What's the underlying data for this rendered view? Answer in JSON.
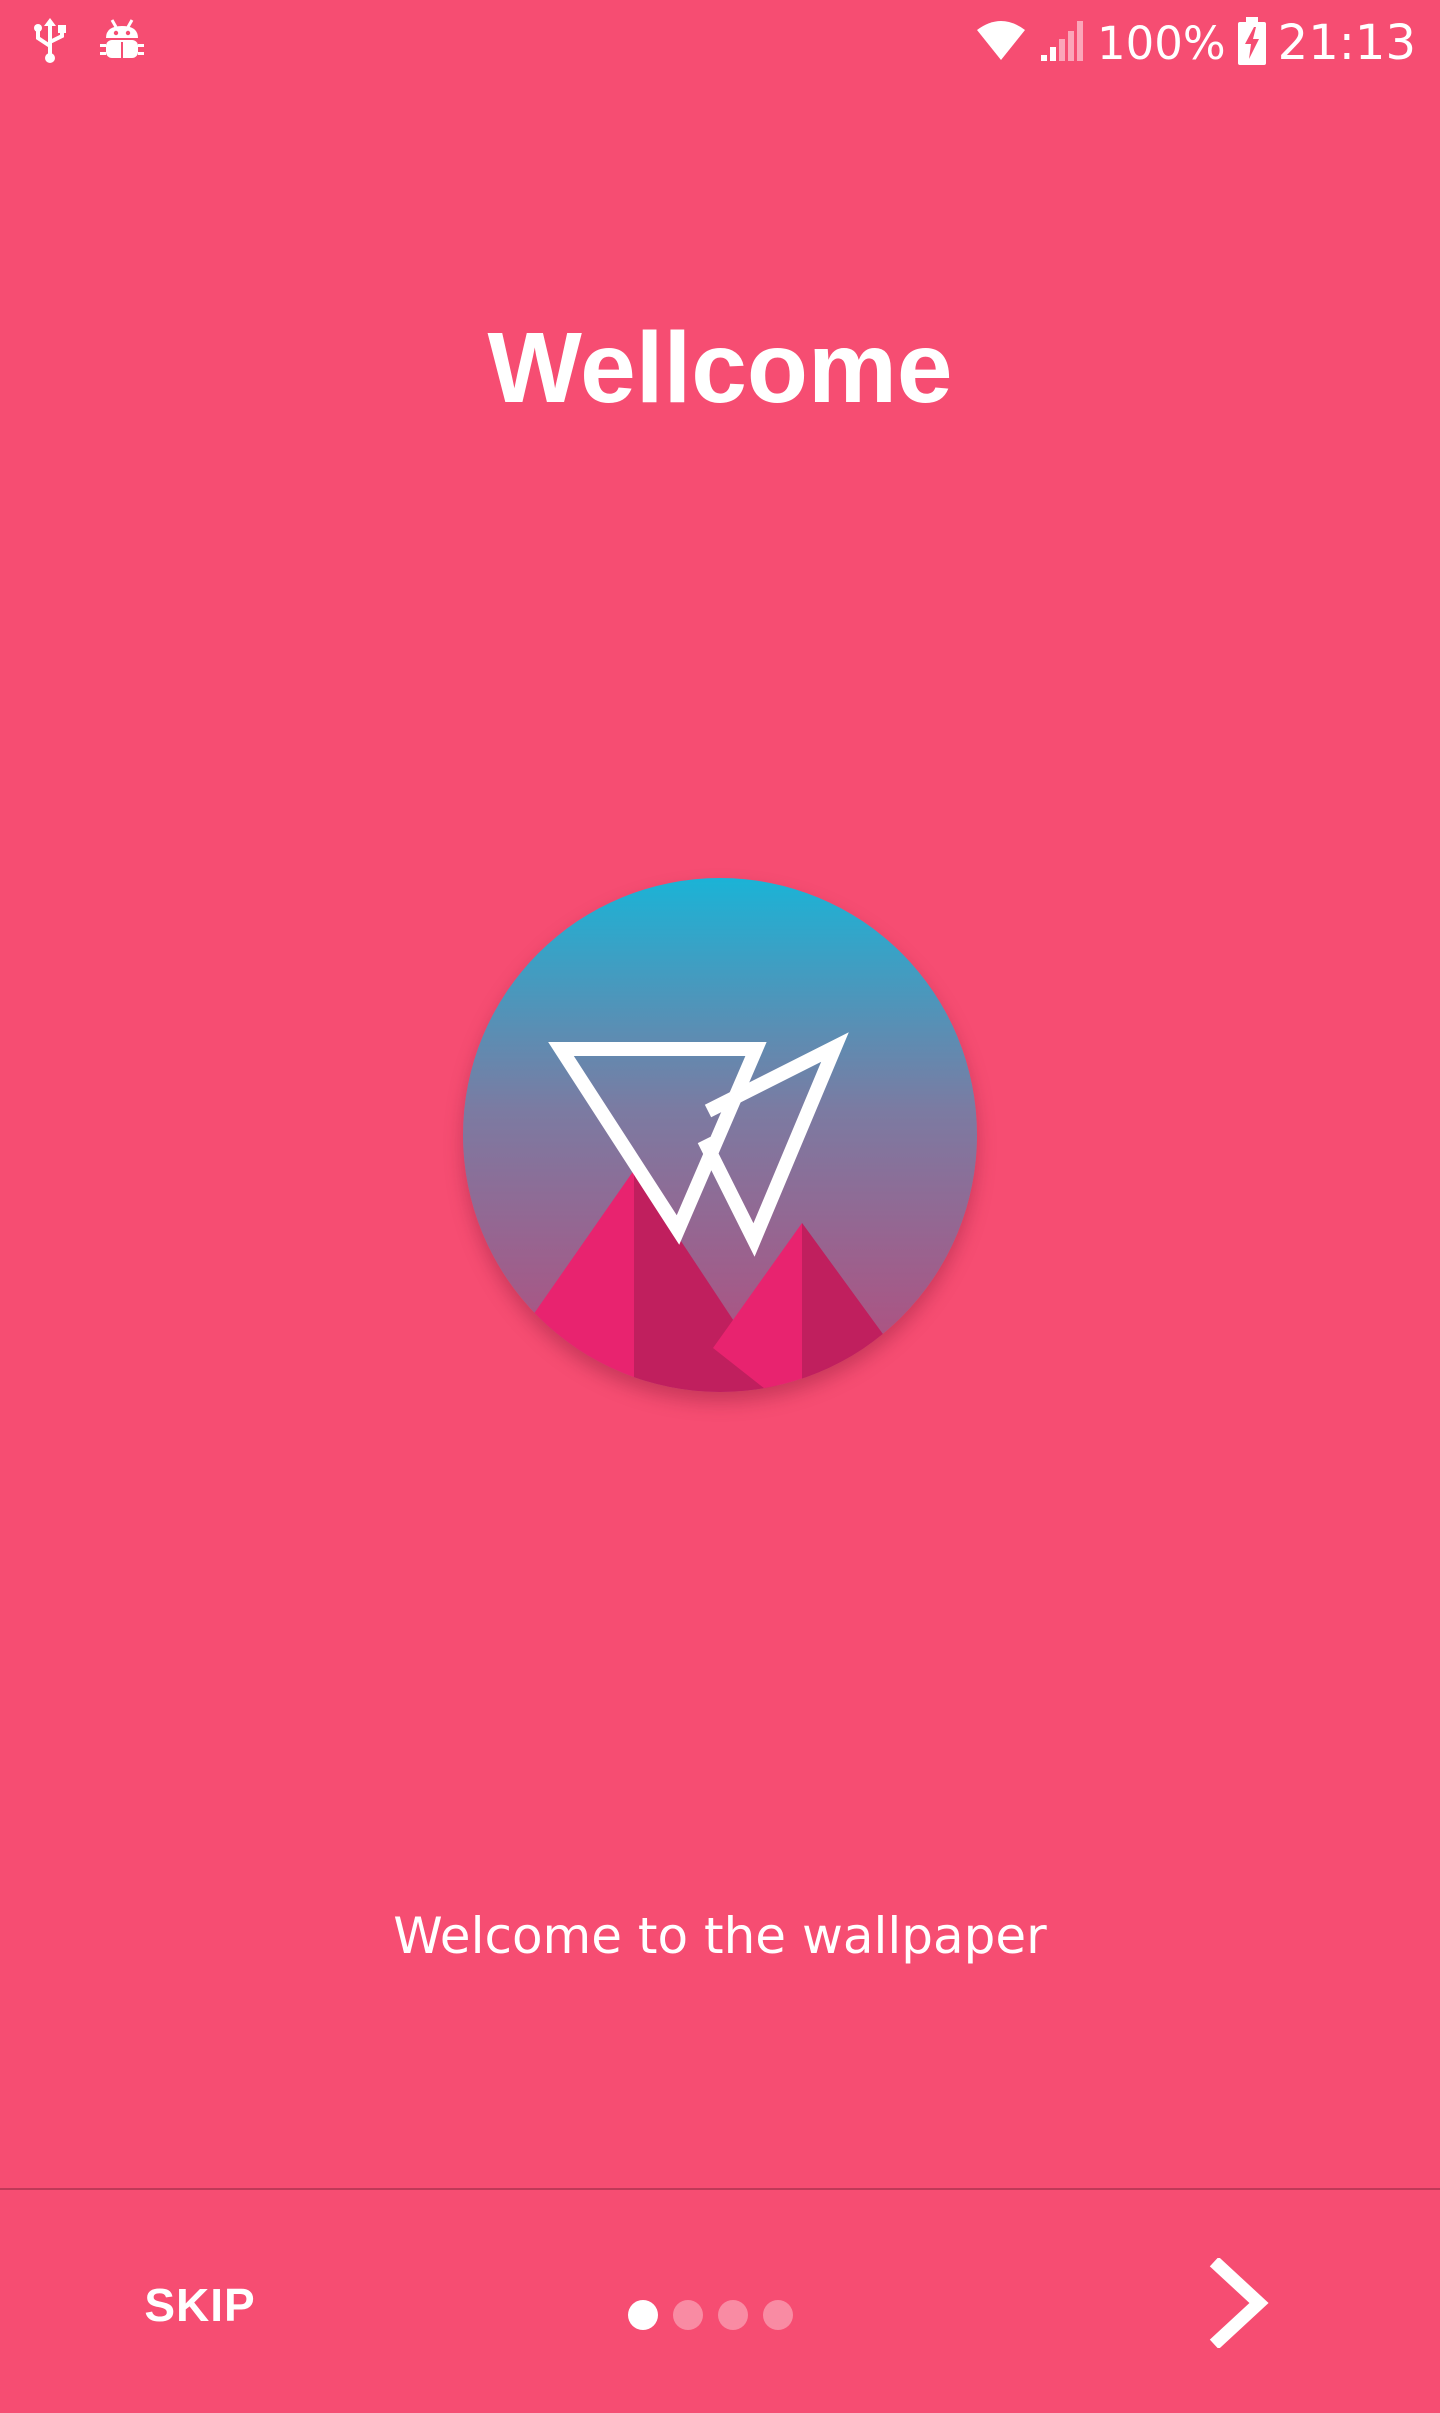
{
  "status_bar": {
    "left_icons": [
      "usb-icon",
      "android-debug-icon"
    ],
    "right_icons": [
      "wifi-icon",
      "cellular-signal-icon",
      "battery-charging-icon"
    ],
    "battery_percent": "100%",
    "time": "21:13"
  },
  "intro": {
    "title": "Wellcome",
    "description": "Welcome to the wallpaper",
    "logo_icon": "wallpaper-app-logo-icon"
  },
  "navigation": {
    "skip_label": "SKIP",
    "next_icon": "chevron-right-icon",
    "page_count": 4,
    "current_page": 1
  },
  "colors": {
    "background": "#f64d72",
    "logo_sky_top": "#1bb3d6",
    "logo_sky_mid": "#7b7ba2",
    "logo_sky_bottom": "#b84a7b",
    "mountain_light": "#e8236f",
    "mountain_dark": "#c01f5e"
  }
}
